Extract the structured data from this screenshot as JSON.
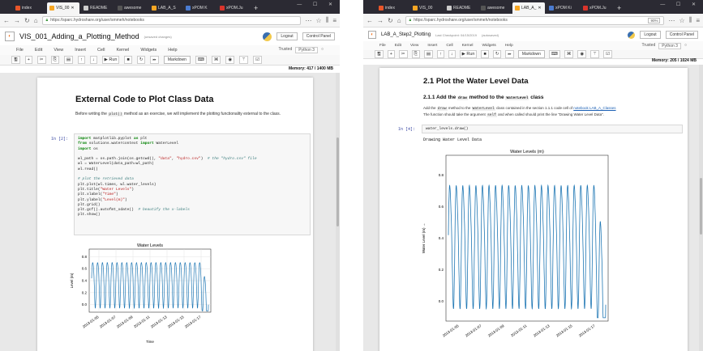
{
  "left": {
    "tabs": [
      {
        "label": "index",
        "color": "#e8562a",
        "active": false
      },
      {
        "label": "VIS_00",
        "color": "#f6a623",
        "active": true
      },
      {
        "label": "README",
        "color": "#cccccc",
        "active": false
      },
      {
        "label": "awesome",
        "color": "#555555",
        "active": false
      },
      {
        "label": "LAB_A_S",
        "color": "#f6a623",
        "active": false
      },
      {
        "label": "xPOM K",
        "color": "#4a7bd0",
        "active": false
      },
      {
        "label": "xPOM.Ju",
        "color": "#d9342b",
        "active": false
      }
    ],
    "url": "https://sparc.hydroshare.org/user/smmeh/notebooks",
    "notebook_title": "VIS_001_Adding_a_Plotting_Method",
    "saved_status": "(unsaved changes)",
    "logout": "Logout",
    "control_panel": "Control Panel",
    "menu": [
      "File",
      "Edit",
      "View",
      "Insert",
      "Cell",
      "Kernel",
      "Widgets",
      "Help"
    ],
    "trusted": "Trusted",
    "kernel": "Python 3",
    "run_label": "Run",
    "cell_type": "Markdown",
    "memory": "Memory: 417 / 1400 MB",
    "heading": "External Code to Plot Class Data",
    "para_a": "Before writing the",
    "para_code": "plot()",
    "para_b": "method as an exercise, we will implement the plotting functionality external to the class.",
    "in_prompt": "In [2]:",
    "plot_title": "Water Levels",
    "ylabel": "Level (m)",
    "xlabel": "Time",
    "yticks": [
      "0.8",
      "0.6",
      "0.4",
      "0.2",
      "0.0"
    ],
    "xticks": [
      "2013-01-05",
      "2013-01-07",
      "2013-01-09",
      "2013-01-11",
      "2013-01-13",
      "2013-01-15",
      "2013-01-17"
    ]
  },
  "right": {
    "tabs": [
      {
        "label": "index",
        "color": "#e8562a",
        "active": false
      },
      {
        "label": "VIS_00",
        "color": "#f6a623",
        "active": false
      },
      {
        "label": "README",
        "color": "#cccccc",
        "active": false
      },
      {
        "label": "awesome",
        "color": "#555555",
        "active": false
      },
      {
        "label": "LAB_A_",
        "color": "#f6a623",
        "active": true
      },
      {
        "label": "xPOM Ki",
        "color": "#4a7bd0",
        "active": false
      },
      {
        "label": "xPOM.Ju",
        "color": "#d9342b",
        "active": false
      }
    ],
    "url": "https://sparc.hydroshare.org/user/smmeh/notebooks",
    "zoom": "90%",
    "notebook_title": "LAB_A_Step2_Plotting",
    "checkpoint": "Last Checkpoint: 04/15/2019",
    "saved_status": "(autosaved)",
    "logout": "Logout",
    "control_panel": "Control Panel",
    "menu": [
      "File",
      "Edit",
      "View",
      "Insert",
      "Cell",
      "Kernel",
      "Widgets",
      "Help"
    ],
    "trusted": "Trusted",
    "kernel": "Python 3",
    "run_label": "Run",
    "cell_type": "Markdown",
    "memory": "Memory: 205 / 1024 MB",
    "heading": "2.1 Plot the Water Level Data",
    "sub_a": "2.1.1 Add the",
    "sub_code1": "draw",
    "sub_b": "method to the",
    "sub_code2": "WaterLevel",
    "sub_c": "class",
    "p1_a": "Add the",
    "p1_code1": "draw",
    "p1_b": "method to the",
    "p1_code2": "WaterLevel",
    "p1_c": "class contained in the section 1.1.1 code cell of",
    "p1_link": "notebook LAB_A_Classes",
    "p2_a": "The function should take the argument",
    "p2_code": "self",
    "p2_b": "and when called should print the line \"Drawing Water Level Data\".",
    "in_prompt": "In [4]:",
    "code": "water_levels.draw()",
    "output": "Drawing Water Level Data",
    "plot_title": "Water Levels (m)",
    "ylabel": "Water Level (m) →",
    "yticks": [
      "0.8",
      "0.6",
      "0.4",
      "0.2",
      "0.0"
    ],
    "xticks": [
      "2013-01-05",
      "2013-01-07",
      "2013-01-09",
      "2013-01-11",
      "2013-01-13",
      "2013-01-15",
      "2013-01-17"
    ]
  }
}
